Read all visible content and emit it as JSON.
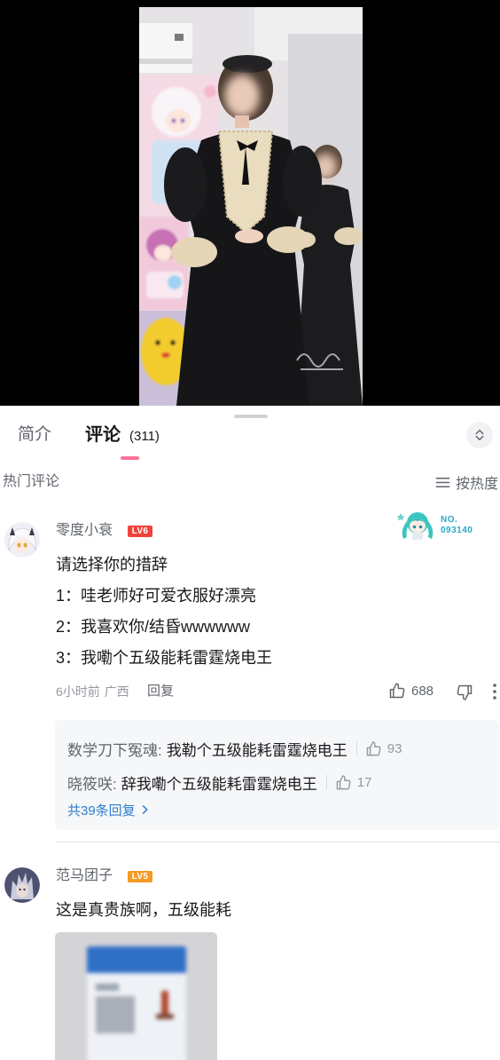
{
  "tabs": {
    "intro_label": "简介",
    "comments_label": "评论",
    "comments_count": "(311)"
  },
  "section": {
    "hot_label": "热门评论",
    "sort_label": "按热度"
  },
  "comments": [
    {
      "username": "零度小衰",
      "level": "LV6",
      "fan_badge": {
        "prefix": "NO.",
        "number": "093140"
      },
      "lines": [
        "请选择你的措辞",
        "1：哇老师好可爱衣服好漂亮",
        "2：我喜欢你/结昏wwwwww",
        "3：我嘞个五级能耗雷霆烧电王"
      ],
      "time": "6小时前",
      "location": "广西",
      "reply_label": "回复",
      "likes": "688",
      "replies": [
        {
          "name": "数学刀下冤魂:",
          "text": "我勒个五级能耗雷霆烧电王",
          "likes": "93"
        },
        {
          "name": "晓筱咲:",
          "text": "辞我嘞个五级能耗雷霆烧电王",
          "likes": "17"
        }
      ],
      "more_replies": "共39条回复"
    },
    {
      "username": "范马团子",
      "level": "LV5",
      "lines": [
        "这是真贵族啊，五级能耗"
      ]
    }
  ],
  "icons": {
    "sort": "sort-lines-icon",
    "toggle": "expand-collapse-icon",
    "like": "thumbs-up-icon",
    "dislike": "thumbs-down-icon",
    "more": "more-vertical-icon",
    "more_replies": "chevron-right-icon"
  },
  "colors": {
    "accent_pink": "#FB7299",
    "text_primary": "#18191C",
    "text_secondary": "#61666D",
    "text_tertiary": "#9499A0",
    "link_blue": "#2E7DD1",
    "level6": "#F0413A",
    "level5": "#F59A23",
    "fan_badge": "#2AA9C4",
    "reply_bg": "#F6F7F8"
  }
}
